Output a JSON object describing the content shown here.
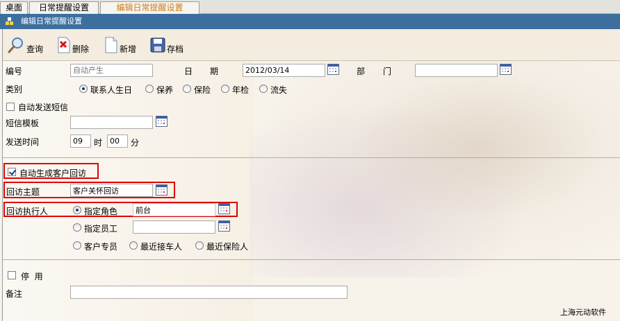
{
  "tabs": [
    {
      "label": "桌面"
    },
    {
      "label": "日常提醒设置"
    },
    {
      "label": "编辑日常提醒设置",
      "active": true
    }
  ],
  "titlebar": {
    "title": "编辑日常提醒设置"
  },
  "toolbar": {
    "query": "查询",
    "delete": "删除",
    "add": "新增",
    "save": "存档"
  },
  "form": {
    "number_label": "编号",
    "number_placeholder": "自动产生",
    "date_label_1": "日",
    "date_label_2": "期",
    "date_value": "2012/03/14",
    "dept_label_1": "部",
    "dept_label_2": "门",
    "dept_value": "",
    "category_label": "类别",
    "categories": [
      "联系人生日",
      "保养",
      "保险",
      "年检",
      "流失"
    ],
    "category_selected": "联系人生日",
    "auto_sms_label": "自动发送短信",
    "sms_template_label": "短信模板",
    "sms_template_value": "",
    "send_time_label": "发送时间",
    "send_hour": "09",
    "hour_unit": "时",
    "send_minute": "00",
    "minute_unit": "分",
    "auto_visit_label": "自动生成客户回访",
    "visit_subject_label": "回访主题",
    "visit_subject_value": "客户关怀回访",
    "visit_executor_label": "回访执行人",
    "assign_role_label": "指定角色",
    "assign_role_value": "前台",
    "assign_staff_label": "指定员工",
    "assign_staff_value": "",
    "customer_rep_label": "客户专员",
    "recent_pickup_label": "最近接车人",
    "recent_insurance_label": "最近保险人",
    "disable_label": "停  用",
    "remark_label": "备注",
    "remark_value": ""
  },
  "footer": {
    "company": "上海元动软件"
  },
  "colors": {
    "titlebar": "#3c6f9e",
    "highlight_box": "#e00000",
    "active_tab": "#d07a16"
  }
}
